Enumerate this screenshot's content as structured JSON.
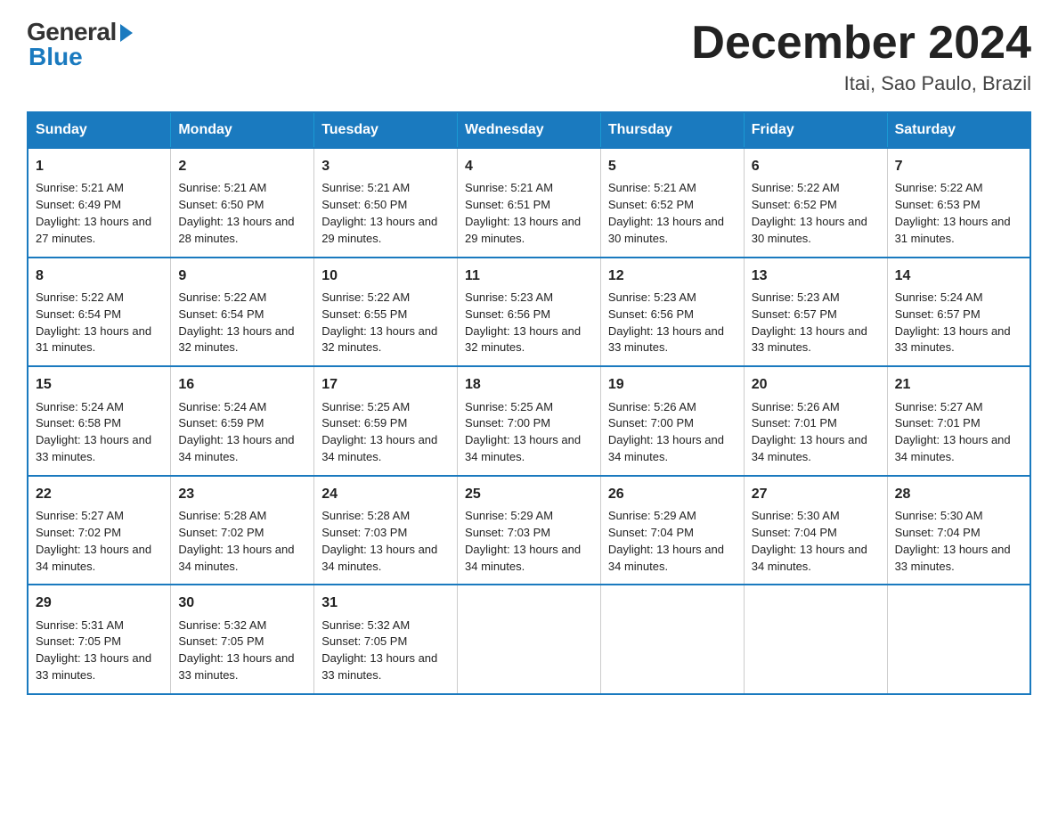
{
  "header": {
    "logo_general": "General",
    "logo_blue": "Blue",
    "month_title": "December 2024",
    "location": "Itai, Sao Paulo, Brazil"
  },
  "columns": [
    "Sunday",
    "Monday",
    "Tuesday",
    "Wednesday",
    "Thursday",
    "Friday",
    "Saturday"
  ],
  "weeks": [
    [
      {
        "day": "1",
        "sunrise": "Sunrise: 5:21 AM",
        "sunset": "Sunset: 6:49 PM",
        "daylight": "Daylight: 13 hours and 27 minutes."
      },
      {
        "day": "2",
        "sunrise": "Sunrise: 5:21 AM",
        "sunset": "Sunset: 6:50 PM",
        "daylight": "Daylight: 13 hours and 28 minutes."
      },
      {
        "day": "3",
        "sunrise": "Sunrise: 5:21 AM",
        "sunset": "Sunset: 6:50 PM",
        "daylight": "Daylight: 13 hours and 29 minutes."
      },
      {
        "day": "4",
        "sunrise": "Sunrise: 5:21 AM",
        "sunset": "Sunset: 6:51 PM",
        "daylight": "Daylight: 13 hours and 29 minutes."
      },
      {
        "day": "5",
        "sunrise": "Sunrise: 5:21 AM",
        "sunset": "Sunset: 6:52 PM",
        "daylight": "Daylight: 13 hours and 30 minutes."
      },
      {
        "day": "6",
        "sunrise": "Sunrise: 5:22 AM",
        "sunset": "Sunset: 6:52 PM",
        "daylight": "Daylight: 13 hours and 30 minutes."
      },
      {
        "day": "7",
        "sunrise": "Sunrise: 5:22 AM",
        "sunset": "Sunset: 6:53 PM",
        "daylight": "Daylight: 13 hours and 31 minutes."
      }
    ],
    [
      {
        "day": "8",
        "sunrise": "Sunrise: 5:22 AM",
        "sunset": "Sunset: 6:54 PM",
        "daylight": "Daylight: 13 hours and 31 minutes."
      },
      {
        "day": "9",
        "sunrise": "Sunrise: 5:22 AM",
        "sunset": "Sunset: 6:54 PM",
        "daylight": "Daylight: 13 hours and 32 minutes."
      },
      {
        "day": "10",
        "sunrise": "Sunrise: 5:22 AM",
        "sunset": "Sunset: 6:55 PM",
        "daylight": "Daylight: 13 hours and 32 minutes."
      },
      {
        "day": "11",
        "sunrise": "Sunrise: 5:23 AM",
        "sunset": "Sunset: 6:56 PM",
        "daylight": "Daylight: 13 hours and 32 minutes."
      },
      {
        "day": "12",
        "sunrise": "Sunrise: 5:23 AM",
        "sunset": "Sunset: 6:56 PM",
        "daylight": "Daylight: 13 hours and 33 minutes."
      },
      {
        "day": "13",
        "sunrise": "Sunrise: 5:23 AM",
        "sunset": "Sunset: 6:57 PM",
        "daylight": "Daylight: 13 hours and 33 minutes."
      },
      {
        "day": "14",
        "sunrise": "Sunrise: 5:24 AM",
        "sunset": "Sunset: 6:57 PM",
        "daylight": "Daylight: 13 hours and 33 minutes."
      }
    ],
    [
      {
        "day": "15",
        "sunrise": "Sunrise: 5:24 AM",
        "sunset": "Sunset: 6:58 PM",
        "daylight": "Daylight: 13 hours and 33 minutes."
      },
      {
        "day": "16",
        "sunrise": "Sunrise: 5:24 AM",
        "sunset": "Sunset: 6:59 PM",
        "daylight": "Daylight: 13 hours and 34 minutes."
      },
      {
        "day": "17",
        "sunrise": "Sunrise: 5:25 AM",
        "sunset": "Sunset: 6:59 PM",
        "daylight": "Daylight: 13 hours and 34 minutes."
      },
      {
        "day": "18",
        "sunrise": "Sunrise: 5:25 AM",
        "sunset": "Sunset: 7:00 PM",
        "daylight": "Daylight: 13 hours and 34 minutes."
      },
      {
        "day": "19",
        "sunrise": "Sunrise: 5:26 AM",
        "sunset": "Sunset: 7:00 PM",
        "daylight": "Daylight: 13 hours and 34 minutes."
      },
      {
        "day": "20",
        "sunrise": "Sunrise: 5:26 AM",
        "sunset": "Sunset: 7:01 PM",
        "daylight": "Daylight: 13 hours and 34 minutes."
      },
      {
        "day": "21",
        "sunrise": "Sunrise: 5:27 AM",
        "sunset": "Sunset: 7:01 PM",
        "daylight": "Daylight: 13 hours and 34 minutes."
      }
    ],
    [
      {
        "day": "22",
        "sunrise": "Sunrise: 5:27 AM",
        "sunset": "Sunset: 7:02 PM",
        "daylight": "Daylight: 13 hours and 34 minutes."
      },
      {
        "day": "23",
        "sunrise": "Sunrise: 5:28 AM",
        "sunset": "Sunset: 7:02 PM",
        "daylight": "Daylight: 13 hours and 34 minutes."
      },
      {
        "day": "24",
        "sunrise": "Sunrise: 5:28 AM",
        "sunset": "Sunset: 7:03 PM",
        "daylight": "Daylight: 13 hours and 34 minutes."
      },
      {
        "day": "25",
        "sunrise": "Sunrise: 5:29 AM",
        "sunset": "Sunset: 7:03 PM",
        "daylight": "Daylight: 13 hours and 34 minutes."
      },
      {
        "day": "26",
        "sunrise": "Sunrise: 5:29 AM",
        "sunset": "Sunset: 7:04 PM",
        "daylight": "Daylight: 13 hours and 34 minutes."
      },
      {
        "day": "27",
        "sunrise": "Sunrise: 5:30 AM",
        "sunset": "Sunset: 7:04 PM",
        "daylight": "Daylight: 13 hours and 34 minutes."
      },
      {
        "day": "28",
        "sunrise": "Sunrise: 5:30 AM",
        "sunset": "Sunset: 7:04 PM",
        "daylight": "Daylight: 13 hours and 33 minutes."
      }
    ],
    [
      {
        "day": "29",
        "sunrise": "Sunrise: 5:31 AM",
        "sunset": "Sunset: 7:05 PM",
        "daylight": "Daylight: 13 hours and 33 minutes."
      },
      {
        "day": "30",
        "sunrise": "Sunrise: 5:32 AM",
        "sunset": "Sunset: 7:05 PM",
        "daylight": "Daylight: 13 hours and 33 minutes."
      },
      {
        "day": "31",
        "sunrise": "Sunrise: 5:32 AM",
        "sunset": "Sunset: 7:05 PM",
        "daylight": "Daylight: 13 hours and 33 minutes."
      },
      null,
      null,
      null,
      null
    ]
  ]
}
